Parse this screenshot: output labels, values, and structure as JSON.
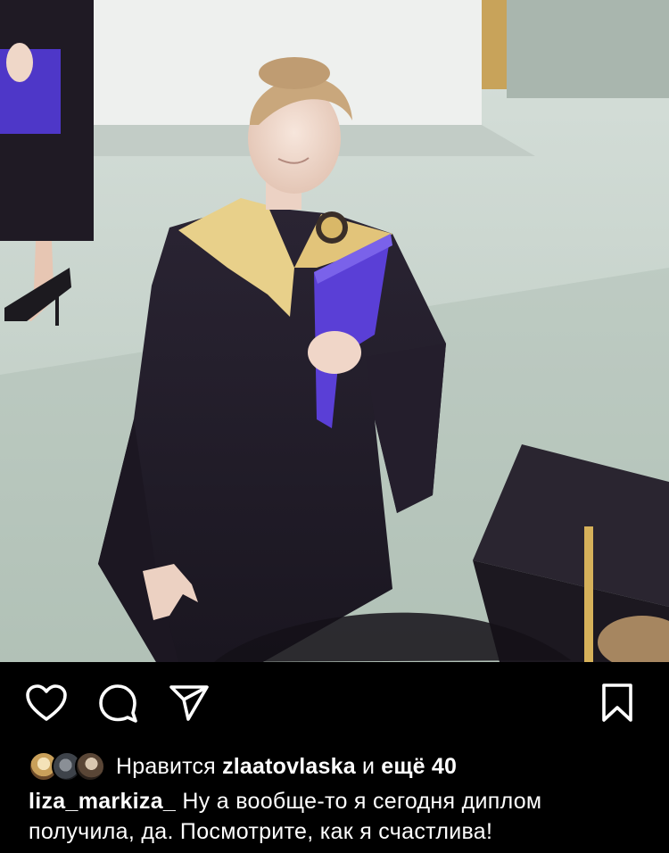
{
  "post": {
    "image_alt": "graduate in black gown with gold collar holding a blue diploma folder"
  },
  "actions": {
    "like_icon": "heart-icon",
    "comment_icon": "comment-bubble-icon",
    "share_icon": "paper-plane-icon",
    "save_icon": "bookmark-icon"
  },
  "likes": {
    "prefix": "Нравится",
    "user": "zlaatovlaska",
    "conjunction": "и",
    "others": "ещё 40"
  },
  "caption": {
    "username": "liza_markiza_",
    "text": "Ну а вообще-то я сегодня диплом получила, да. Посмотрите, как я счастлива!"
  },
  "colors": {
    "background": "#000000",
    "text": "#ffffff",
    "folder_blue": "#5a3fd6",
    "collar_gold": "#e8d08a"
  }
}
